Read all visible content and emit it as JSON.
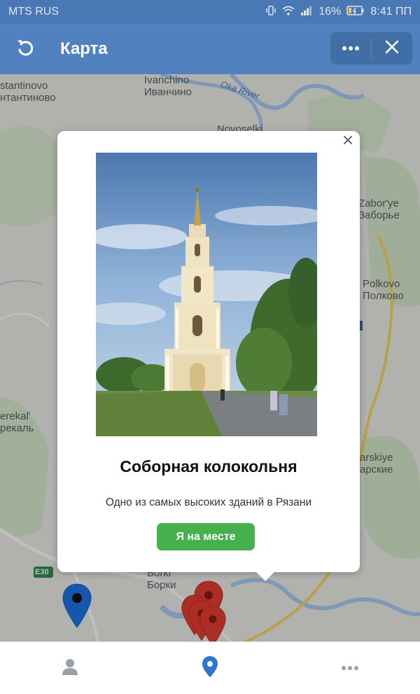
{
  "status_bar": {
    "carrier": "MTS RUS",
    "battery": "16%",
    "time": "8:41 ПП",
    "icons": [
      "vibrate-icon",
      "wifi-icon",
      "signal-icon",
      "battery-charging-icon"
    ]
  },
  "header": {
    "title": "Карта",
    "back_icon": "refresh-back-icon",
    "more_icon": "more-dots-icon",
    "close_icon": "close-icon"
  },
  "map": {
    "labels": {
      "ivanchino_en": "Ivanchino",
      "ivanchino_ru": "Иванчино",
      "konstantinovo_en": "stantinovo",
      "konstantinovo_ru": "нтантиново",
      "oka_river": "Oka River",
      "novoselki": "Novoselki",
      "zaborye_en": "Zabor'ye",
      "zaborye_ru": "Заборье",
      "polkovo_en": "Polkovo",
      "polkovo_ru": "Полково",
      "shumashi_en": "erekal'",
      "shumashi_ru": "рекаль",
      "tsarskiye_en": "arskiye",
      "tsarskiye_ru": "арские",
      "borki_en": "Borki",
      "borki_ru": "Борки",
      "road_e30": "E30"
    },
    "colors": {
      "water": "#a9cbf2",
      "park": "#cfe6c4",
      "road_major": "#f5d764",
      "road_minor": "#ffffff",
      "pin_red": "#e43d2f",
      "pin_blue": "#1c74e6"
    }
  },
  "popup": {
    "title": "Соборная колокольня",
    "description": "Одно из самых высоких зданий в Рязани",
    "button_label": "Я на месте",
    "close_icon": "close-icon",
    "image_subject": "bell-tower-photo",
    "button_color": "#46b04c"
  },
  "bottom_nav": {
    "items": [
      {
        "icon": "user-icon",
        "active": false
      },
      {
        "icon": "map-pin-icon",
        "active": true
      },
      {
        "icon": "more-dots-icon",
        "active": false
      }
    ],
    "active_color": "#2f76d2",
    "inactive_color": "#9aa0a8"
  }
}
